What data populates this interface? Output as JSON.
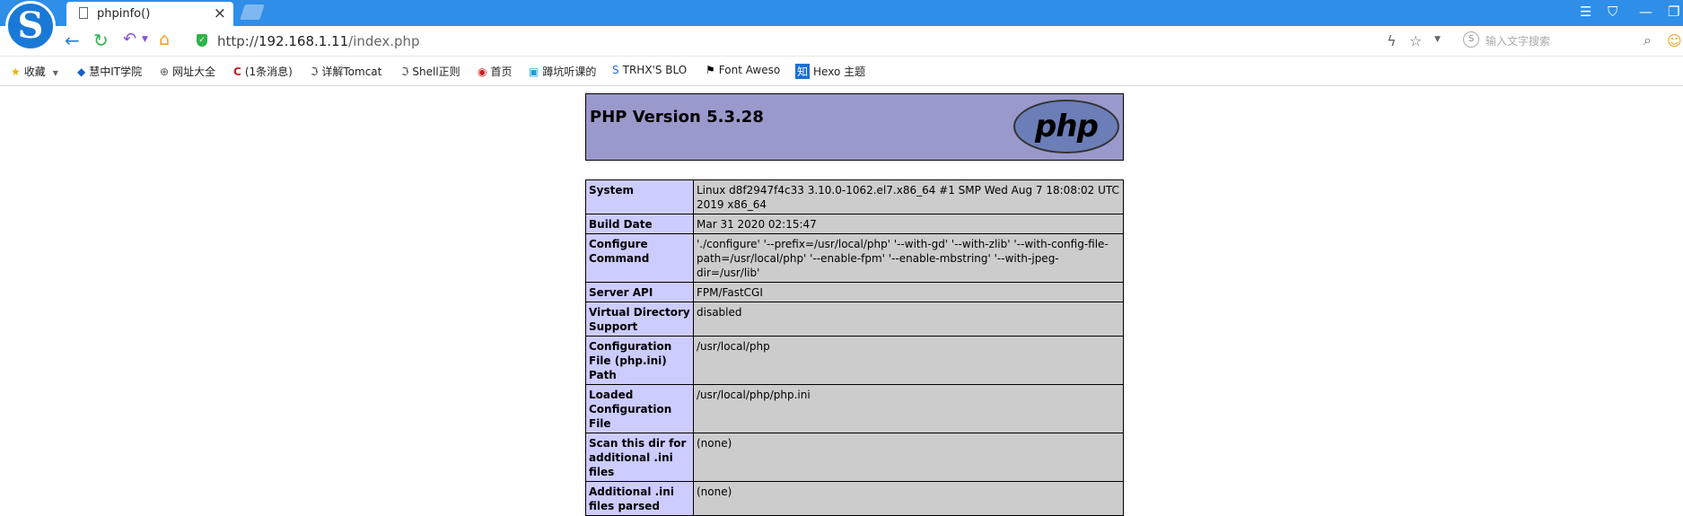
{
  "browser": {
    "tab": {
      "title": "phpinfo()",
      "close": "×"
    },
    "address": {
      "scheme": "http://",
      "host": "192.168.1.11",
      "path": "/index.php"
    },
    "search": {
      "placeholder": "输入文字搜索"
    },
    "bookmarks": [
      {
        "label": "收藏",
        "icon": "star-icon"
      },
      {
        "label": "慧中IT学院",
        "icon": "site-icon"
      },
      {
        "label": "网址大全",
        "icon": "globe-icon"
      },
      {
        "label": "(1条消息)",
        "icon": "csdn-icon"
      },
      {
        "label": "详解Tomcat",
        "icon": "site-icon"
      },
      {
        "label": "Shell正则",
        "icon": "site-icon"
      },
      {
        "label": "首页",
        "icon": "site-icon"
      },
      {
        "label": "蹲坑听课的",
        "icon": "bilibili-icon"
      },
      {
        "label": "TRHX'S BLO",
        "icon": "site-icon"
      },
      {
        "label": "Font Aweso",
        "icon": "flag-icon"
      },
      {
        "label": "Hexo 主题",
        "icon": "zhihu-icon"
      }
    ]
  },
  "phpinfo": {
    "title": "PHP Version 5.3.28",
    "logo_text": "php",
    "rows": [
      {
        "key": "System",
        "value": "Linux d8f2947f4c33 3.10.0-1062.el7.x86_64 #1 SMP Wed Aug 7 18:08:02 UTC 2019 x86_64"
      },
      {
        "key": "Build Date",
        "value": "Mar 31 2020 02:15:47"
      },
      {
        "key": "Configure Command",
        "value": "'./configure' '--prefix=/usr/local/php' '--with-gd' '--with-zlib' '--with-config-file-path=/usr/local/php' '--enable-fpm' '--enable-mbstring' '--with-jpeg-dir=/usr/lib'"
      },
      {
        "key": "Server API",
        "value": "FPM/FastCGI"
      },
      {
        "key": "Virtual Directory Support",
        "value": "disabled"
      },
      {
        "key": "Configuration File (php.ini) Path",
        "value": "/usr/local/php"
      },
      {
        "key": "Loaded Configuration File",
        "value": "/usr/local/php/php.ini"
      },
      {
        "key": "Scan this dir for additional .ini files",
        "value": "(none)"
      },
      {
        "key": "Additional .ini files parsed",
        "value": "(none)"
      }
    ]
  }
}
